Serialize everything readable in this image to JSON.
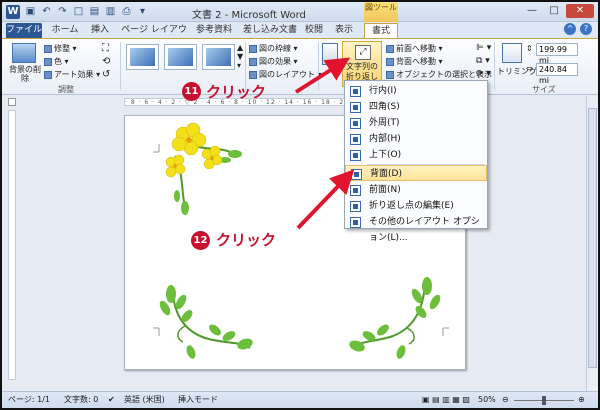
{
  "title_bar": {
    "doc_title": "文書 2 - Microsoft Word",
    "tool_context": "図ツール",
    "word_logo": "W"
  },
  "tabs": [
    "ファイル",
    "ホーム",
    "挿入",
    "ページ レイアウト",
    "参考資料",
    "差し込み文書",
    "校閲",
    "表示",
    "書式"
  ],
  "ribbon": {
    "remove_bg": "背景の削除",
    "adjust_items": [
      "修整",
      "色",
      "アート効果"
    ],
    "adjust_group": "調整",
    "border_items": [
      "図の枠線",
      "図の効果",
      "図のレイアウト"
    ],
    "wrap_button": "文字列の折り返し",
    "arrange_items": [
      "前面へ移動",
      "背面へ移動",
      "オブジェクトの選択と表示"
    ],
    "trim": "トリミング",
    "height_value": "199.99 mi",
    "width_value": "240.84 mi",
    "size_group": "サイズ"
  },
  "menu": {
    "items": [
      "行内(I)",
      "四角(S)",
      "外周(T)",
      "内部(H)",
      "上下(O)",
      "背面(D)",
      "前面(N)",
      "折り返し点の編集(E)",
      "その他のレイアウト オプション(L)..."
    ],
    "highlighted": "背面(D)"
  },
  "annotations": {
    "step1_num": "11",
    "step1_text": "クリック",
    "step2_num": "12",
    "step2_text": "クリック",
    "color": "#c8102e"
  },
  "status": {
    "page": "ページ: 1/1",
    "chars": "文字数: 0",
    "lang": "英語 (米国)",
    "mode": "挿入モード",
    "zoom": "50%"
  }
}
